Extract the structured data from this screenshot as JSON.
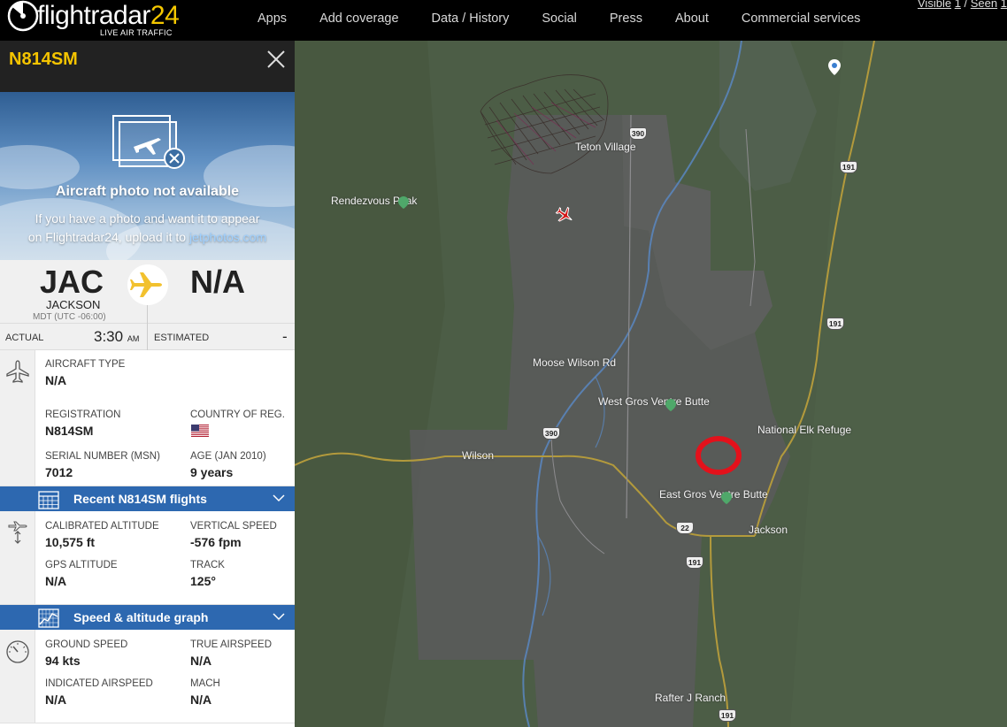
{
  "nav": {
    "logo_main": "flightradar",
    "logo_num": "24",
    "logo_tagline": "LIVE AIR TRAFFIC",
    "items": [
      "Apps",
      "Add coverage",
      "Data / History",
      "Social",
      "Press",
      "About",
      "Commercial services"
    ],
    "visible_label": "Visible",
    "visible_count": "1",
    "seen_label": "Seen",
    "seen_count": "1"
  },
  "panel": {
    "callsign": "N814SM",
    "photo": {
      "title": "Aircraft photo not available",
      "message_line1": "If you have a photo and want it to appear",
      "message_line2": "on Flightradar24, upload it to",
      "link": "jetphotos.com"
    },
    "route": {
      "origin_code": "JAC",
      "origin_city": "JACKSON",
      "origin_tz": "MDT (UTC -06:00)",
      "dest_code": "N/A"
    },
    "times": {
      "actual_label": "ACTUAL",
      "actual_time": "3:30",
      "actual_ampm": "AM",
      "estimated_label": "ESTIMATED",
      "estimated_value": "-"
    },
    "aircraft": {
      "type_label": "AIRCRAFT TYPE",
      "type_value": "N/A",
      "reg_label": "REGISTRATION",
      "reg_value": "N814SM",
      "country_label": "COUNTRY OF REG.",
      "serial_label": "SERIAL NUMBER (MSN)",
      "serial_value": "7012",
      "age_label": "AGE (JAN 2010)",
      "age_value": "9 years"
    },
    "recent_bar": "Recent N814SM flights",
    "altitude": {
      "cal_alt_label": "CALIBRATED ALTITUDE",
      "cal_alt_value": "10,575 ft",
      "vs_label": "VERTICAL SPEED",
      "vs_value": "-576 fpm",
      "gps_label": "GPS ALTITUDE",
      "gps_value": "N/A",
      "track_label": "TRACK",
      "track_value": "125°"
    },
    "graph_bar": "Speed & altitude graph",
    "speed": {
      "gs_label": "GROUND SPEED",
      "gs_value": "94 kts",
      "tas_label": "TRUE AIRSPEED",
      "tas_value": "N/A",
      "ias_label": "INDICATED AIRSPEED",
      "ias_value": "N/A",
      "mach_label": "MACH",
      "mach_value": "N/A"
    }
  },
  "map": {
    "labels": {
      "teton_village": "Teton Village",
      "rendezvous": "Rendezvous Peak",
      "moose_wilson": "Moose Wilson Rd",
      "west_gros": "West Gros Ventre Butte",
      "national_elk": "National Elk Refuge",
      "wilson": "Wilson",
      "east_gros": "East Gros Ventre Butte",
      "jackson": "Jackson",
      "rafter": "Rafter J Ranch"
    },
    "shields": {
      "s390a": "390",
      "s390b": "390",
      "s191a": "191",
      "s191b": "191",
      "s191c": "191",
      "s191d": "191",
      "s22": "22"
    },
    "colors": {
      "highlight_ring": "#e3111b",
      "aircraft": "#d31616"
    }
  }
}
